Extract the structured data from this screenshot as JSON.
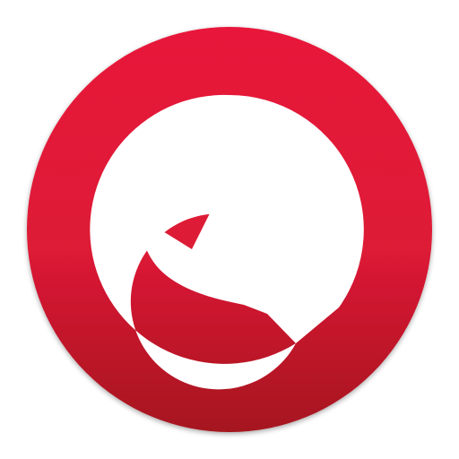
{
  "icon": {
    "name": "wrench-tool-icon",
    "colors": {
      "background": "#ffffff",
      "circle_top": "#e8193a",
      "circle_mid": "#dd1a36",
      "circle_bottom": "#a5121f",
      "glyph": "#ffffff"
    }
  }
}
